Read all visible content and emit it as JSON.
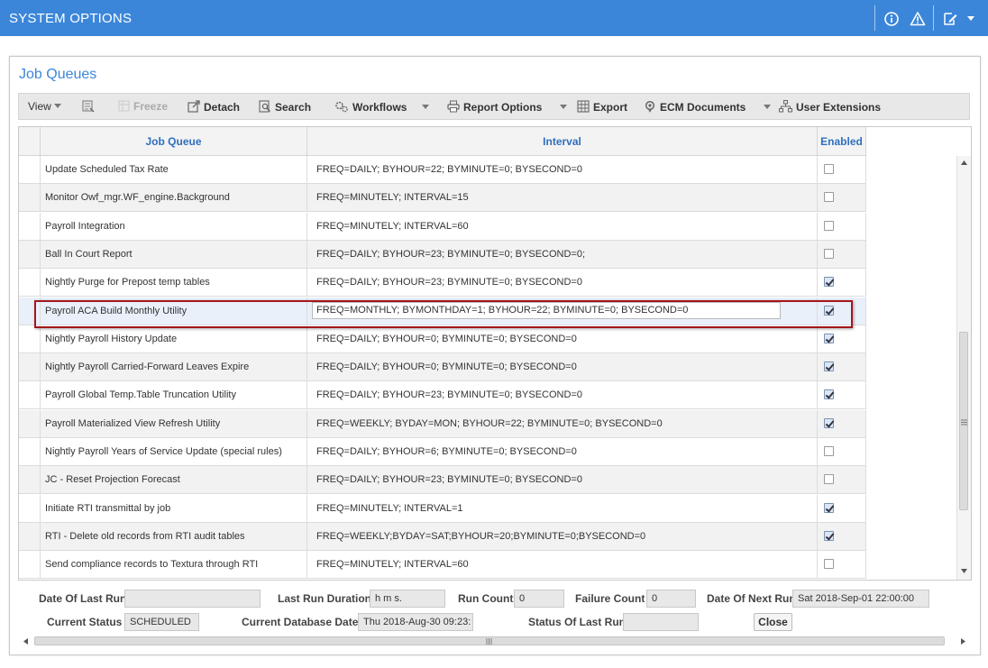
{
  "header": {
    "title": "SYSTEM OPTIONS"
  },
  "panel": {
    "title": "Job Queues"
  },
  "toolbar": {
    "view": "View",
    "freeze": "Freeze",
    "detach": "Detach",
    "search": "Search",
    "workflows": "Workflows",
    "report_options": "Report Options",
    "export": "Export",
    "ecm_documents": "ECM Documents",
    "user_extensions": "User Extensions"
  },
  "grid": {
    "columns": {
      "job_queue": "Job Queue",
      "interval": "Interval",
      "enabled": "Enabled"
    },
    "rows": [
      {
        "job_queue": "Update Scheduled Tax Rate",
        "interval": "FREQ=DAILY; BYHOUR=22; BYMINUTE=0; BYSECOND=0",
        "enabled": false
      },
      {
        "job_queue": "Monitor Owf_mgr.WF_engine.Background",
        "interval": "FREQ=MINUTELY; INTERVAL=15",
        "enabled": false
      },
      {
        "job_queue": "Payroll Integration",
        "interval": "FREQ=MINUTELY; INTERVAL=60",
        "enabled": false
      },
      {
        "job_queue": "Ball In Court Report",
        "interval": "FREQ=DAILY; BYHOUR=23; BYMINUTE=0; BYSECOND=0;",
        "enabled": false
      },
      {
        "job_queue": "Nightly Purge for Prepost temp tables",
        "interval": "FREQ=DAILY; BYHOUR=23; BYMINUTE=0; BYSECOND=0",
        "enabled": true
      },
      {
        "job_queue": "Payroll ACA Build Monthly Utility",
        "interval": "FREQ=MONTHLY; BYMONTHDAY=1; BYHOUR=22; BYMINUTE=0; BYSECOND=0",
        "enabled": true
      },
      {
        "job_queue": "Nightly Payroll History Update",
        "interval": "FREQ=DAILY; BYHOUR=0; BYMINUTE=0; BYSECOND=0",
        "enabled": true
      },
      {
        "job_queue": "Nightly Payroll Carried-Forward Leaves Expire",
        "interval": "FREQ=DAILY; BYHOUR=0; BYMINUTE=0; BYSECOND=0",
        "enabled": true
      },
      {
        "job_queue": "Payroll Global Temp.Table Truncation Utility",
        "interval": "FREQ=DAILY; BYHOUR=23; BYMINUTE=0; BYSECOND=0",
        "enabled": true
      },
      {
        "job_queue": "Payroll Materialized View Refresh Utility",
        "interval": "FREQ=WEEKLY; BYDAY=MON; BYHOUR=22; BYMINUTE=0; BYSECOND=0",
        "enabled": true
      },
      {
        "job_queue": "Nightly Payroll Years of Service Update (special rules)",
        "interval": "FREQ=DAILY; BYHOUR=6; BYMINUTE=0; BYSECOND=0",
        "enabled": false
      },
      {
        "job_queue": "JC - Reset Projection Forecast",
        "interval": "FREQ=DAILY; BYHOUR=23; BYMINUTE=0; BYSECOND=0",
        "enabled": false
      },
      {
        "job_queue": "Initiate RTI transmittal by job",
        "interval": "FREQ=MINUTELY; INTERVAL=1",
        "enabled": true
      },
      {
        "job_queue": "RTI - Delete old records from RTI audit tables",
        "interval": "FREQ=WEEKLY;BYDAY=SAT;BYHOUR=20;BYMINUTE=0;BYSECOND=0",
        "enabled": true
      },
      {
        "job_queue": "Send compliance records to Textura through RTI",
        "interval": "FREQ=MINUTELY; INTERVAL=60",
        "enabled": false
      }
    ]
  },
  "footer": {
    "date_of_last_run_label": "Date Of Last Run",
    "date_of_last_run": "",
    "last_run_duration_label": "Last Run Duration",
    "last_run_duration": "h m s.",
    "run_count_label": "Run Count",
    "run_count": "0",
    "failure_count_label": "Failure Count",
    "failure_count": "0",
    "date_of_next_run_label": "Date Of Next Run",
    "date_of_next_run": "Sat 2018-Sep-01 22:00:00",
    "current_status_label": "Current Status",
    "current_status": "SCHEDULED",
    "current_db_date_label": "Current Database Date",
    "current_db_date": "Thu 2018-Aug-30 09:23:",
    "status_of_last_run_label": "Status Of Last Run",
    "status_of_last_run": "",
    "close_label": "Close"
  },
  "colors": {
    "header_bg": "#3b86d9",
    "link_blue": "#2f6fbf",
    "highlight_border": "#a3161b"
  },
  "icons": [
    "info-icon",
    "warning-icon",
    "edit-note-icon",
    "chevron-down-icon",
    "freeze-icon",
    "detach-icon",
    "search-icon",
    "workflows-gear-icon",
    "print-icon",
    "export-icon",
    "ecm-documents-icon",
    "user-extensions-icon"
  ]
}
